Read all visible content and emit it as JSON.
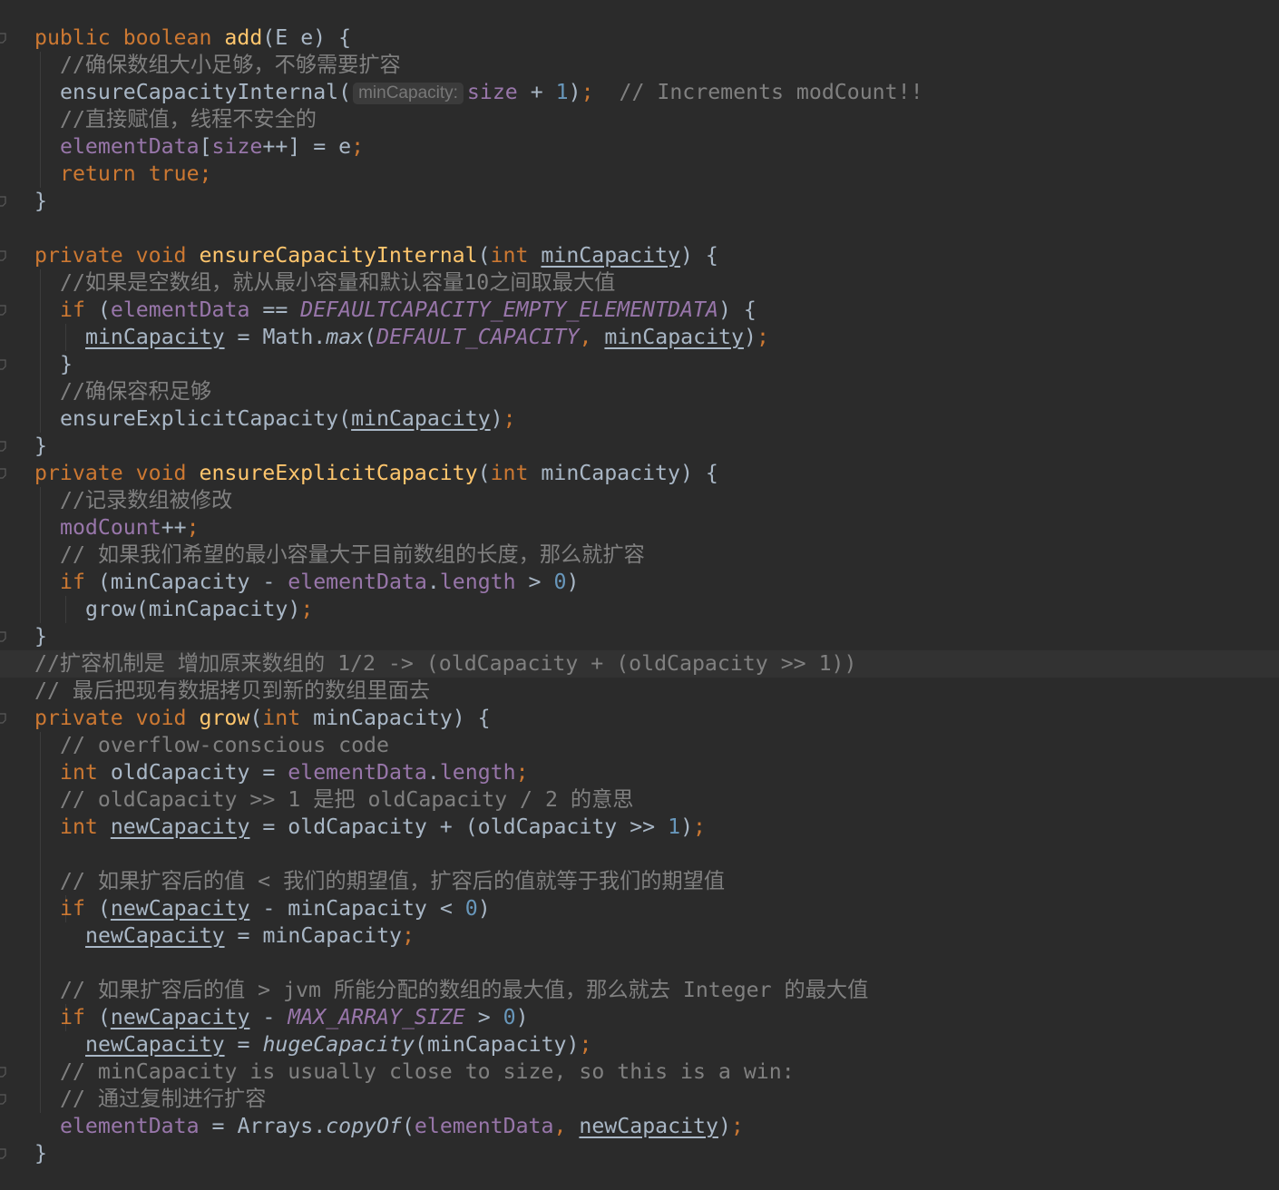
{
  "editor": {
    "language": "java",
    "theme": "darcula",
    "colors": {
      "background": "#2b2b2b",
      "current_line": "#323232",
      "keyword": "#cc7832",
      "method_declaration": "#ffc66d",
      "field": "#9876aa",
      "number": "#6897bb",
      "comment": "#808080",
      "plain": "#a9b7c6"
    },
    "highlighted_line_index": 23,
    "fold_marker_icon": "fold-marker-icon",
    "lines": [
      {
        "indent": 0,
        "tokens": [
          {
            "t": "public boolean ",
            "c": "kw"
          },
          {
            "t": "add",
            "c": "fn"
          },
          {
            "t": "(",
            "c": "pl"
          },
          {
            "t": "E",
            "c": "pl"
          },
          {
            "t": " e) {",
            "c": "pl"
          }
        ]
      },
      {
        "indent": 1,
        "tokens": [
          {
            "t": "//确保数组大小足够，不够需要扩容",
            "c": "cm"
          }
        ]
      },
      {
        "indent": 1,
        "tokens": [
          {
            "t": "ensureCapacityInternal(",
            "c": "pl"
          },
          {
            "t": "minCapacity:",
            "c": "hint"
          },
          {
            "t": "size",
            "c": "fld"
          },
          {
            "t": " + ",
            "c": "pl"
          },
          {
            "t": "1",
            "c": "num"
          },
          {
            "t": ")",
            "c": "pl"
          },
          {
            "t": ";",
            "c": "kw"
          },
          {
            "t": "  // Increments modCount!!",
            "c": "cm"
          }
        ]
      },
      {
        "indent": 1,
        "tokens": [
          {
            "t": "//直接赋值，线程不安全的",
            "c": "cm"
          }
        ]
      },
      {
        "indent": 1,
        "tokens": [
          {
            "t": "elementData",
            "c": "fld"
          },
          {
            "t": "[",
            "c": "pl"
          },
          {
            "t": "size",
            "c": "fld"
          },
          {
            "t": "++] = e",
            "c": "pl"
          },
          {
            "t": ";",
            "c": "kw"
          }
        ]
      },
      {
        "indent": 1,
        "tokens": [
          {
            "t": "return true;",
            "c": "kw"
          }
        ]
      },
      {
        "indent": 0,
        "tokens": [
          {
            "t": "}",
            "c": "pl"
          }
        ]
      },
      {
        "indent": 0,
        "tokens": []
      },
      {
        "indent": 0,
        "tokens": [
          {
            "t": "private void ",
            "c": "kw"
          },
          {
            "t": "ensureCapacityInternal",
            "c": "fn"
          },
          {
            "t": "(",
            "c": "pl"
          },
          {
            "t": "int ",
            "c": "kw"
          },
          {
            "t": "minCapacity",
            "c": "ul"
          },
          {
            "t": ") {",
            "c": "pl"
          }
        ]
      },
      {
        "indent": 1,
        "tokens": [
          {
            "t": "//如果是空数组，就从最小容量和默认容量10之间取最大值",
            "c": "cm"
          }
        ]
      },
      {
        "indent": 1,
        "tokens": [
          {
            "t": "if ",
            "c": "kw"
          },
          {
            "t": "(",
            "c": "pl"
          },
          {
            "t": "elementData",
            "c": "fld"
          },
          {
            "t": " == ",
            "c": "pl"
          },
          {
            "t": "DEFAULTCAPACITY_EMPTY_ELEMENTDATA",
            "c": "cst"
          },
          {
            "t": ") {",
            "c": "pl"
          }
        ]
      },
      {
        "indent": 2,
        "tokens": [
          {
            "t": "minCapacity",
            "c": "ul"
          },
          {
            "t": " = Math.",
            "c": "pl"
          },
          {
            "t": "max",
            "c": "it"
          },
          {
            "t": "(",
            "c": "pl"
          },
          {
            "t": "DEFAULT_CAPACITY",
            "c": "cst"
          },
          {
            "t": ", ",
            "c": "kw"
          },
          {
            "t": "minCapacity",
            "c": "ul"
          },
          {
            "t": ")",
            "c": "pl"
          },
          {
            "t": ";",
            "c": "kw"
          }
        ]
      },
      {
        "indent": 1,
        "tokens": [
          {
            "t": "}",
            "c": "pl"
          }
        ]
      },
      {
        "indent": 1,
        "tokens": [
          {
            "t": "//确保容积足够",
            "c": "cm"
          }
        ]
      },
      {
        "indent": 1,
        "tokens": [
          {
            "t": "ensureExplicitCapacity(",
            "c": "pl"
          },
          {
            "t": "minCapacity",
            "c": "ul"
          },
          {
            "t": ")",
            "c": "pl"
          },
          {
            "t": ";",
            "c": "kw"
          }
        ]
      },
      {
        "indent": 0,
        "tokens": [
          {
            "t": "}",
            "c": "pl"
          }
        ]
      },
      {
        "indent": 0,
        "tokens": [
          {
            "t": "private void ",
            "c": "kw"
          },
          {
            "t": "ensureExplicitCapacity",
            "c": "fn"
          },
          {
            "t": "(",
            "c": "pl"
          },
          {
            "t": "int ",
            "c": "kw"
          },
          {
            "t": "minCapacity) {",
            "c": "pl"
          }
        ]
      },
      {
        "indent": 1,
        "tokens": [
          {
            "t": "//记录数组被修改",
            "c": "cm"
          }
        ]
      },
      {
        "indent": 1,
        "tokens": [
          {
            "t": "modCount",
            "c": "fld"
          },
          {
            "t": "++",
            "c": "pl"
          },
          {
            "t": ";",
            "c": "kw"
          }
        ]
      },
      {
        "indent": 1,
        "tokens": [
          {
            "t": "// 如果我们希望的最小容量大于目前数组的长度，那么就扩容",
            "c": "cm"
          }
        ]
      },
      {
        "indent": 1,
        "tokens": [
          {
            "t": "if ",
            "c": "kw"
          },
          {
            "t": "(minCapacity - ",
            "c": "pl"
          },
          {
            "t": "elementData",
            "c": "fld"
          },
          {
            "t": ".",
            "c": "pl"
          },
          {
            "t": "length",
            "c": "fld"
          },
          {
            "t": " > ",
            "c": "pl"
          },
          {
            "t": "0",
            "c": "num"
          },
          {
            "t": ")",
            "c": "pl"
          }
        ]
      },
      {
        "indent": 2,
        "tokens": [
          {
            "t": "grow(minCapacity)",
            "c": "pl"
          },
          {
            "t": ";",
            "c": "kw"
          }
        ]
      },
      {
        "indent": 0,
        "tokens": [
          {
            "t": "}",
            "c": "pl"
          }
        ]
      },
      {
        "indent": 0,
        "tokens": [
          {
            "t": "//扩容机制是 增加原来数组的 1/2 -> (oldCapacity + (oldCapacity >> 1))",
            "c": "cm"
          }
        ]
      },
      {
        "indent": 0,
        "tokens": [
          {
            "t": "// 最后把现有数据拷贝到新的数组里面去",
            "c": "cm"
          }
        ]
      },
      {
        "indent": 0,
        "tokens": [
          {
            "t": "private void ",
            "c": "kw"
          },
          {
            "t": "grow",
            "c": "fn"
          },
          {
            "t": "(",
            "c": "pl"
          },
          {
            "t": "int ",
            "c": "kw"
          },
          {
            "t": "minCapacity) {",
            "c": "pl"
          }
        ]
      },
      {
        "indent": 1,
        "tokens": [
          {
            "t": "// overflow-conscious code",
            "c": "cm"
          }
        ]
      },
      {
        "indent": 1,
        "tokens": [
          {
            "t": "int ",
            "c": "kw"
          },
          {
            "t": "oldCapacity = ",
            "c": "pl"
          },
          {
            "t": "elementData",
            "c": "fld"
          },
          {
            "t": ".",
            "c": "pl"
          },
          {
            "t": "length",
            "c": "fld"
          },
          {
            "t": ";",
            "c": "kw"
          }
        ]
      },
      {
        "indent": 1,
        "tokens": [
          {
            "t": "// oldCapacity >> 1 是把 oldCapacity / 2 的意思",
            "c": "cm"
          }
        ]
      },
      {
        "indent": 1,
        "tokens": [
          {
            "t": "int ",
            "c": "kw"
          },
          {
            "t": "newCapacity",
            "c": "ul"
          },
          {
            "t": " = oldCapacity + (oldCapacity >> ",
            "c": "pl"
          },
          {
            "t": "1",
            "c": "num"
          },
          {
            "t": ")",
            "c": "pl"
          },
          {
            "t": ";",
            "c": "kw"
          }
        ]
      },
      {
        "indent": 0,
        "tokens": []
      },
      {
        "indent": 1,
        "tokens": [
          {
            "t": "// 如果扩容后的值 < 我们的期望值，扩容后的值就等于我们的期望值",
            "c": "cm"
          }
        ]
      },
      {
        "indent": 1,
        "tokens": [
          {
            "t": "if ",
            "c": "kw"
          },
          {
            "t": "(",
            "c": "pl"
          },
          {
            "t": "newCapacity",
            "c": "ul"
          },
          {
            "t": " - minCapacity < ",
            "c": "pl"
          },
          {
            "t": "0",
            "c": "num"
          },
          {
            "t": ")",
            "c": "pl"
          }
        ]
      },
      {
        "indent": 2,
        "tokens": [
          {
            "t": "newCapacity",
            "c": "ul"
          },
          {
            "t": " = minCapacity",
            "c": "pl"
          },
          {
            "t": ";",
            "c": "kw"
          }
        ]
      },
      {
        "indent": 0,
        "tokens": []
      },
      {
        "indent": 1,
        "tokens": [
          {
            "t": "// 如果扩容后的值 > jvm 所能分配的数组的最大值，那么就去 Integer 的最大值",
            "c": "cm"
          }
        ]
      },
      {
        "indent": 1,
        "tokens": [
          {
            "t": "if ",
            "c": "kw"
          },
          {
            "t": "(",
            "c": "pl"
          },
          {
            "t": "newCapacity",
            "c": "ul"
          },
          {
            "t": " - ",
            "c": "pl"
          },
          {
            "t": "MAX_ARRAY_SIZE",
            "c": "cst"
          },
          {
            "t": " > ",
            "c": "pl"
          },
          {
            "t": "0",
            "c": "num"
          },
          {
            "t": ")",
            "c": "pl"
          }
        ]
      },
      {
        "indent": 2,
        "tokens": [
          {
            "t": "newCapacity",
            "c": "ul"
          },
          {
            "t": " = ",
            "c": "pl"
          },
          {
            "t": "hugeCapacity",
            "c": "it"
          },
          {
            "t": "(minCapacity)",
            "c": "pl"
          },
          {
            "t": ";",
            "c": "kw"
          }
        ]
      },
      {
        "indent": 1,
        "tokens": [
          {
            "t": "// minCapacity is usually close to size, so this is a win:",
            "c": "cm"
          }
        ]
      },
      {
        "indent": 1,
        "tokens": [
          {
            "t": "// 通过复制进行扩容",
            "c": "cm"
          }
        ]
      },
      {
        "indent": 1,
        "tokens": [
          {
            "t": "elementData",
            "c": "fld"
          },
          {
            "t": " = Arrays.",
            "c": "pl"
          },
          {
            "t": "copyOf",
            "c": "it"
          },
          {
            "t": "(",
            "c": "pl"
          },
          {
            "t": "elementData",
            "c": "fld"
          },
          {
            "t": ", ",
            "c": "kw"
          },
          {
            "t": "newCapacity",
            "c": "ul"
          },
          {
            "t": ")",
            "c": "pl"
          },
          {
            "t": ";",
            "c": "kw"
          }
        ]
      },
      {
        "indent": 0,
        "tokens": [
          {
            "t": "}",
            "c": "pl"
          }
        ]
      }
    ]
  }
}
